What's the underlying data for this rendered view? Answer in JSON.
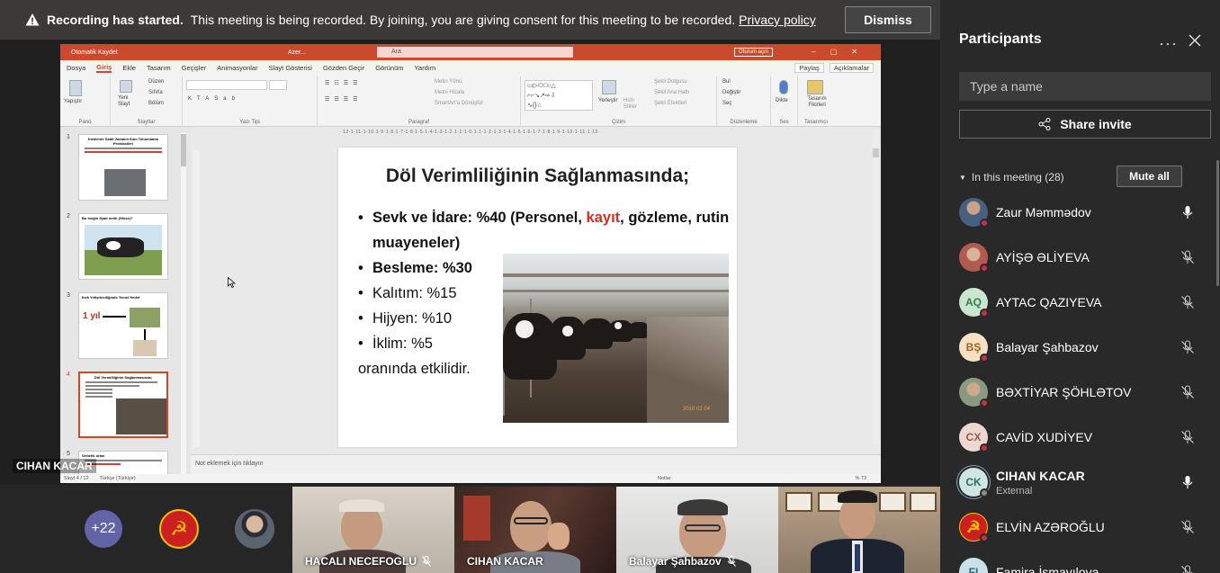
{
  "banner": {
    "title": "Recording has started.",
    "message": "This meeting is being recorded. By joining, you are giving consent for this meeting to be recorded.",
    "link": "Privacy policy",
    "dismiss": "Dismiss"
  },
  "ppt": {
    "autosave": "Otomatik Kaydet",
    "doc_name": "Azer...",
    "search": "Ara",
    "signin": "Oturum açın",
    "menu": [
      "Dosya",
      "Giriş",
      "Ekle",
      "Tasarım",
      "Geçişler",
      "Animasyonlar",
      "Slayt Gösterisi",
      "Gözden Geçir",
      "Görünüm",
      "Yardım"
    ],
    "share": "Paylaş",
    "comments": "Açıklamalar",
    "ribbon": {
      "paste": "Yapıştır",
      "pano": "Pano",
      "new_slide": "Yeni Slayt",
      "layout": "Düzen",
      "reset": "Sıfırla",
      "section": "Bölüm",
      "slides": "Slaytlar",
      "font_type": "Yazı Tipi",
      "paragraph": "Paragraf",
      "text_direction": "Metin Yönü",
      "align_text": "Metni Hizala",
      "smartart": "SmartArt'a Dönüştür",
      "arrange": "Yerleştir",
      "quick_styles": "Hızlı Stiller",
      "shape_fill": "Şekil Dolgusu",
      "shape_outline": "Şekil Ana Hattı",
      "shape_effects": "Şekil Efektleri",
      "drawing": "Çizim",
      "find": "Bul",
      "replace": "Değiştir",
      "select": "Seç",
      "editing": "Düzenleme",
      "dictate": "Dikte",
      "voice": "Ses",
      "design_ideas": "Tasarım Fikirleri",
      "designer": "Tasarımcı"
    },
    "ruler": "·12·1·11·1·10·1·9·1·8·1·7·1·6·1·5·1·4·1·3·1·2·1·1·1·0·1·1·1·2·1·3·1·4·1·5·1·6·1·7·1·8·1·9·1·10·1·11·1·12·",
    "thumbnails": [
      {
        "num": "1",
        "title": "İneklerde Sabit Zamanlı Suni Tohumlama Protokolleri"
      },
      {
        "num": "2",
        "title": "Bu ineğin fiyatı nedir (Hisse)?"
      },
      {
        "num": "3",
        "title": "İnek Yetiştiriciliğinde Temel Hedef",
        "extra": "1 yıl"
      },
      {
        "num": "4",
        "title": "Döl Verimliliğinin Sağlanmasında;"
      },
      {
        "num": "5",
        "title": "Gebelik oranı"
      }
    ],
    "slide": {
      "title": "Döl Verimliliğinin Sağlanmasında;",
      "bullet1_a": "Sevk  ve İdare: %40 (Personel, ",
      "bullet1_red": "kayıt",
      "bullet1_b": ", gözleme, rutin muayeneler)",
      "bullet2": "Besleme: %30",
      "bullet3": "Kalıtım: %15",
      "bullet4": "Hijyen: %10",
      "bullet5": "İklim: %5",
      "closing": "oranında etkilidir."
    },
    "notes_placeholder": "Not eklemek için tıklayın",
    "status_slide": "Slayt 4 / 12",
    "status_lang": "Türkçe (Türkiye)",
    "status_notes": "Notlar",
    "zoom": "% 73"
  },
  "presenter_label": "CIHAN KACAR",
  "gallery": {
    "more_count": "+22",
    "tiles": [
      {
        "name": "HACALI NECEFOGLU"
      },
      {
        "name": "CIHAN KACAR"
      },
      {
        "name": "Balayar Şahbazov"
      }
    ]
  },
  "panel": {
    "title": "Participants",
    "more": "···",
    "search_placeholder": "Type a name",
    "share_invite": "Share invite",
    "in_meeting": "In this meeting (28)",
    "mute_all": "Mute all",
    "participants": [
      {
        "name": "Zaur Məmmədov",
        "initials": "",
        "mic": "on"
      },
      {
        "name": "AYİŞƏ ƏLİYEVA",
        "initials": "",
        "mic": "off"
      },
      {
        "name": "AYTAC QAZIYEVA",
        "initials": "AQ",
        "mic": "off"
      },
      {
        "name": "Balayar Şahbazov",
        "initials": "BŞ",
        "mic": "off"
      },
      {
        "name": "BƏXTİYAR ŞÖHLƏTOV",
        "initials": "",
        "mic": "off"
      },
      {
        "name": "CAVİD XUDİYEV",
        "initials": "CX",
        "mic": "off"
      },
      {
        "name": "CIHAN KACAR",
        "initials": "CK",
        "sub": "External",
        "mic": "on"
      },
      {
        "name": "ELVİN AZƏROĞLU",
        "initials": "",
        "mic": "off"
      },
      {
        "name": "Famira İsmayılova",
        "initials": "FI",
        "mic": "off"
      }
    ]
  },
  "colors": {
    "accent": "#6264a7",
    "ppt_orange": "#c94b2c",
    "busy_red": "#c4314b",
    "panel_bg": "#292929"
  }
}
